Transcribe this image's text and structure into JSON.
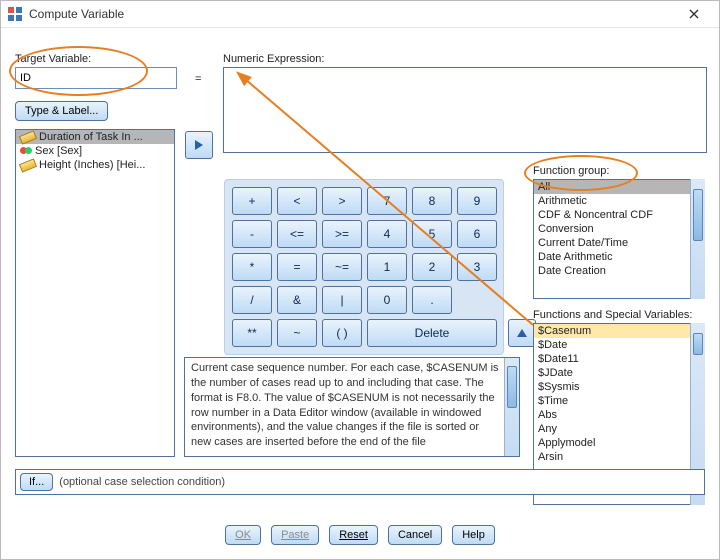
{
  "window": {
    "title": "Compute Variable"
  },
  "labels": {
    "target_variable": "Target Variable:",
    "numeric_expression": "Numeric Expression:",
    "type_and_label": "Type & Label...",
    "equals": "=",
    "function_group": "Function group:",
    "functions_special": "Functions and Special Variables:",
    "if_button": "If...",
    "if_text": "(optional case selection condition)"
  },
  "target_variable_value": "ID",
  "numeric_expression_value": "",
  "variables": [
    {
      "icon": "ruler",
      "text": "Duration of Task In ..."
    },
    {
      "icon": "venn",
      "text": "Sex [Sex]"
    },
    {
      "icon": "ruler",
      "text": "Height (Inches) [Hei..."
    }
  ],
  "keypad": {
    "rows": [
      [
        "+",
        "<",
        ">",
        "7",
        "8",
        "9"
      ],
      [
        "-",
        "<=",
        ">=",
        "4",
        "5",
        "6"
      ],
      [
        "*",
        "=",
        "~=",
        "1",
        "2",
        "3"
      ],
      [
        "/",
        "&",
        "|",
        "0",
        ".",
        ""
      ],
      [
        "**",
        "~",
        "( )",
        "Delete",
        "",
        ""
      ]
    ]
  },
  "function_groups": [
    "All",
    "Arithmetic",
    "CDF & Noncentral CDF",
    "Conversion",
    "Current Date/Time",
    "Date Arithmetic",
    "Date Creation"
  ],
  "functions": [
    "$Casenum",
    "$Date",
    "$Date11",
    "$JDate",
    "$Sysmis",
    "$Time",
    "Abs",
    "Any",
    "Applymodel",
    "Arsin"
  ],
  "description_text": "Current case sequence number. For each case, $CASENUM is the number of cases read up to and including that case. The format is F8.0. The value of $CASENUM is not necessarily the row number in a Data Editor window (available in windowed environments), and the value changes if the file is sorted or new cases are inserted before the end of the file",
  "footer": {
    "ok": "OK",
    "paste": "Paste",
    "reset": "Reset",
    "cancel": "Cancel",
    "help": "Help"
  }
}
